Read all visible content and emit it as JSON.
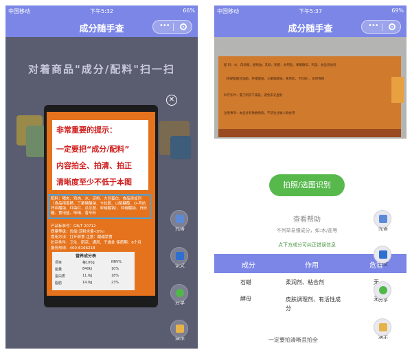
{
  "left_phone": {
    "status": {
      "carrier": "中国移动",
      "time": "下午5:32",
      "battery": "66%"
    },
    "nav": {
      "title": "成分随手查"
    },
    "headline": "对着商品\"成分/配料\"扫一扫",
    "tip": {
      "line1": "非常重要的提示：",
      "line2": "一定要把“成分/配料”",
      "line3": "内容拍全、拍清、拍正",
      "line4": "清晰度至少不低于本图"
    },
    "label_text": {
      "ingredients": "配料：猪肉、鸡肉、水、淀粉、大豆蛋白、食品添加剂（食品用香精、三聚磷酸钠、卡拉胶、山梨糖醇、D-异抗坏血酸钠、红曲红、瓜尔胶、亚硝酸钠）、亚硝酸钠、白砂糖、食用盐、味精、香辛料",
      "license": "产品标准号：GB/T 20712",
      "grade": "质量等级：优级(淀粉含量<8%)",
      "usage": "食用方法：打开即食    注意：酸碱禁食",
      "storage": "贮存条件：卫生、阴凉、通风、干燥处  保质期：6个月",
      "hotline": "服务热线：400-6166218",
      "nutrition_title": "营养成分表",
      "nutrition_headers": [
        "项目",
        "每100g",
        "NRV%"
      ],
      "nutrition_rows": [
        [
          "能量",
          "840kJ",
          "10%"
        ],
        [
          "蛋白质",
          "11.0g",
          "18%"
        ],
        [
          "脂肪",
          "14.0g",
          "23%"
        ]
      ]
    },
    "side_buttons": [
      {
        "label": "完善",
        "icon": "edit-icon"
      },
      {
        "label": "识文",
        "icon": "word-icon"
      },
      {
        "label": "分享",
        "icon": "wechat-icon"
      },
      {
        "label": "演示",
        "icon": "demo-icon"
      }
    ]
  },
  "right_phone": {
    "status": {
      "carrier": "中国移动",
      "time": "下午5:37",
      "battery": "69%"
    },
    "nav": {
      "title": "成分随手查"
    },
    "photo_text": {
      "line1": "配    料：水、白砂糖、植物油、乳粉、明胶、食用盐、果葡糖浆、鸡蛋、食品添加剂",
      "line2": "（单硬脂酸甘油酯、柠檬酸钠、三聚磷酸钠、黄原胶、卡拉胶）、食用香精",
      "line3": "贮存条件：置于阴凉干燥处，避免阳光直射",
      "line4": "注意事项：本品含有致敏物质，不适合过敏人群食用"
    },
    "scan_button": "拍照/选图识别",
    "help_title": "查看帮助",
    "help_sub": "不列举易懂成分，如:水/盐等",
    "feedback": "点下方成分可纠正错误信息",
    "table": {
      "headers": [
        "成分",
        "作用",
        "危害"
      ],
      "rows": [
        {
          "name": "石蜡",
          "effect": "柔润剂、粘合剂",
          "harm": "无"
        },
        {
          "name": "酵母",
          "effect": "皮肤调理剂、有活性成分",
          "harm": "无"
        }
      ]
    },
    "footer": "一定要拍清晰且拍全",
    "side_buttons": [
      {
        "label": "完善",
        "icon": "edit-icon"
      },
      {
        "label": "识文",
        "icon": "word-icon"
      },
      {
        "label": "分享",
        "icon": "wechat-icon"
      },
      {
        "label": "演示",
        "icon": "demo-icon"
      }
    ]
  },
  "colors": {
    "nav": "#7b86e6",
    "overlay": "#5a5c70",
    "accent_green": "#57b94c",
    "warning_red": "#d01e1e",
    "label_orange": "#e5731d"
  }
}
